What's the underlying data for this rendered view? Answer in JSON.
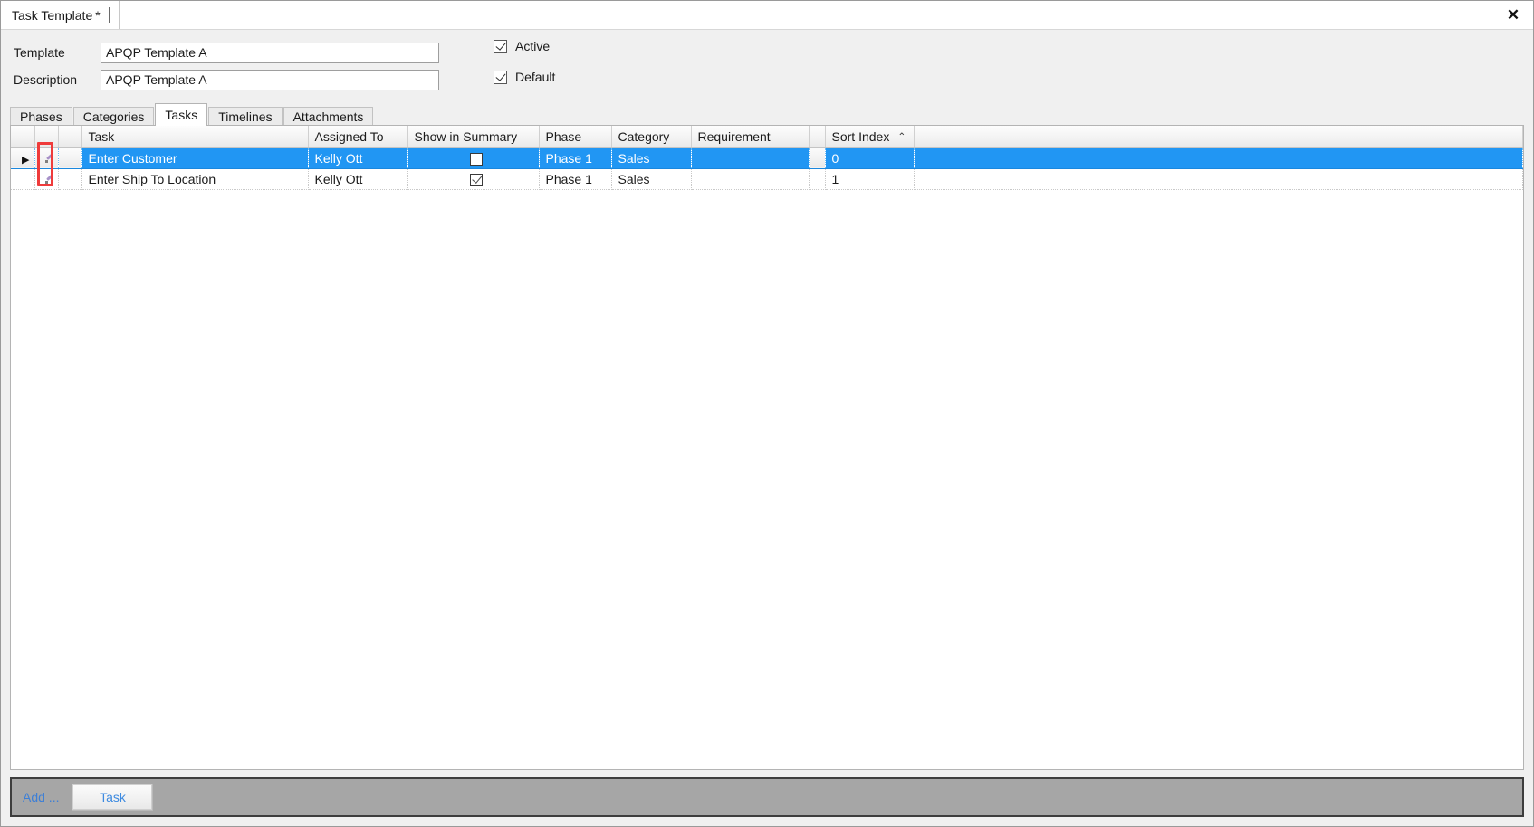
{
  "window": {
    "doc_tab_title": "Task Template",
    "dirty_marker": "*",
    "close_icon": "✕"
  },
  "form": {
    "template_label": "Template",
    "template_value": "APQP Template A",
    "template_placeholder": "",
    "description_label": "Description",
    "description_value": "APQP Template A",
    "description_placeholder": "",
    "active_label": "Active",
    "active_checked": true,
    "default_label": "Default",
    "default_checked": true
  },
  "tabs": [
    {
      "label": "Phases",
      "active": false
    },
    {
      "label": "Categories",
      "active": false
    },
    {
      "label": "Tasks",
      "active": true
    },
    {
      "label": "Timelines",
      "active": false
    },
    {
      "label": "Attachments",
      "active": false
    }
  ],
  "grid": {
    "columns": [
      "Task",
      "Assigned To",
      "Show in Summary",
      "Phase",
      "Category",
      "Requirement",
      "Sort Index"
    ],
    "sorted_column": "Sort Index",
    "sort_direction_icon": "⌃",
    "row_indicator_icon": "▶",
    "edit_icon": "pencil-icon",
    "rows": [
      {
        "selected": true,
        "current": true,
        "task": "Enter Customer",
        "assigned_to": "Kelly Ott",
        "show_in_summary": false,
        "phase": "Phase 1",
        "category": "Sales",
        "requirement": "",
        "sort_index": "0"
      },
      {
        "selected": false,
        "current": false,
        "task": "Enter Ship To Location",
        "assigned_to": "Kelly Ott",
        "show_in_summary": true,
        "phase": "Phase 1",
        "category": "Sales",
        "requirement": "",
        "sort_index": "1"
      }
    ]
  },
  "bottom_bar": {
    "add_label": "Add ...",
    "task_button_label": "Task"
  },
  "colors": {
    "selection_blue": "#2196f3",
    "annotation_red": "#ef3b3b",
    "link_blue": "#3d8ae0",
    "bottom_bar_gray": "#a6a6a6"
  }
}
